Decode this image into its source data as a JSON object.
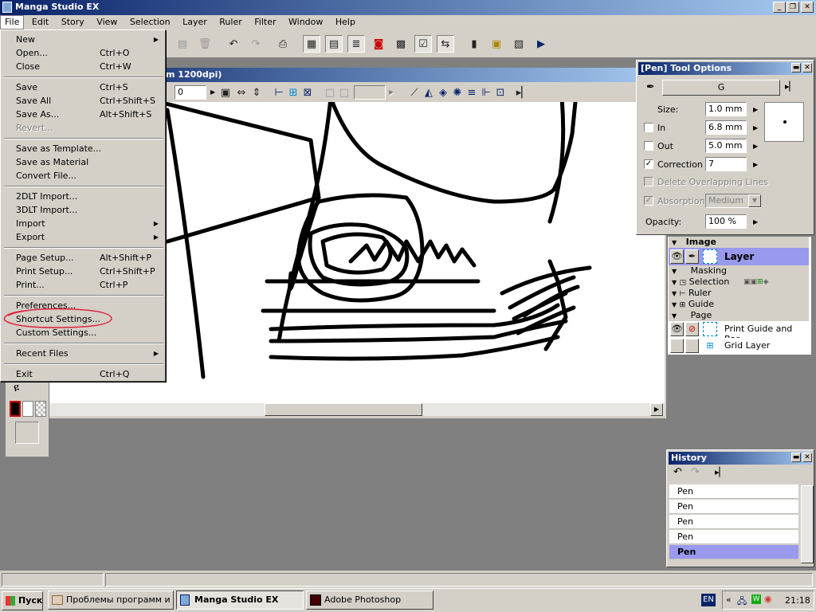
{
  "app": {
    "title": "Manga Studio EX"
  },
  "menubar": [
    "File",
    "Edit",
    "Story",
    "View",
    "Selection",
    "Layer",
    "Ruler",
    "Filter",
    "Window",
    "Help"
  ],
  "file_menu": [
    {
      "label": "New",
      "shortcut": "",
      "submenu": true,
      "disabled": false
    },
    {
      "label": "Open...",
      "shortcut": "Ctrl+O",
      "submenu": false,
      "disabled": false
    },
    {
      "label": "Close",
      "shortcut": "Ctrl+W",
      "submenu": false,
      "disabled": false
    },
    {
      "sep": true
    },
    {
      "label": "Save",
      "shortcut": "Ctrl+S",
      "submenu": false,
      "disabled": false
    },
    {
      "label": "Save All",
      "shortcut": "Ctrl+Shift+S",
      "submenu": false,
      "disabled": false
    },
    {
      "label": "Save As...",
      "shortcut": "Alt+Shift+S",
      "submenu": false,
      "disabled": false
    },
    {
      "label": "Revert...",
      "shortcut": "",
      "submenu": false,
      "disabled": true
    },
    {
      "sep": true
    },
    {
      "label": "Save as Template...",
      "shortcut": "",
      "submenu": false,
      "disabled": false
    },
    {
      "label": "Save as Material",
      "shortcut": "",
      "submenu": false,
      "disabled": false
    },
    {
      "label": "Convert File...",
      "shortcut": "",
      "submenu": false,
      "disabled": false
    },
    {
      "sep": true
    },
    {
      "label": "2DLT Import...",
      "shortcut": "",
      "submenu": false,
      "disabled": false
    },
    {
      "label": "3DLT Import...",
      "shortcut": "",
      "submenu": false,
      "disabled": false
    },
    {
      "label": "Import",
      "shortcut": "",
      "submenu": true,
      "disabled": false
    },
    {
      "label": "Export",
      "shortcut": "",
      "submenu": true,
      "disabled": false
    },
    {
      "sep": true
    },
    {
      "label": "Page Setup...",
      "shortcut": "Alt+Shift+P",
      "submenu": false,
      "disabled": false
    },
    {
      "label": "Print Setup...",
      "shortcut": "Ctrl+Shift+P",
      "submenu": false,
      "disabled": false
    },
    {
      "label": "Print...",
      "shortcut": "Ctrl+P",
      "submenu": false,
      "disabled": false
    },
    {
      "sep": true
    },
    {
      "label": "Preferences...",
      "shortcut": "",
      "submenu": false,
      "disabled": false
    },
    {
      "label": "Shortcut Settings...",
      "shortcut": "",
      "submenu": false,
      "disabled": false
    },
    {
      "label": "Custom Settings...",
      "shortcut": "",
      "submenu": false,
      "disabled": false
    },
    {
      "sep": true
    },
    {
      "label": "Recent Files",
      "shortcut": "",
      "submenu": true,
      "disabled": false
    },
    {
      "sep": true
    },
    {
      "label": "Exit",
      "shortcut": "Ctrl+Q",
      "submenu": false,
      "disabled": false
    }
  ],
  "doc": {
    "title_fragment": "m 1200dpi)",
    "zoom_field": "0"
  },
  "tool_options": {
    "title": "[Pen] Tool Options",
    "preset": "G",
    "size_label": "Size:",
    "size_value": "1.0 mm",
    "in_label": "In",
    "in_value": "6.8 mm",
    "in_checked": false,
    "out_label": "Out",
    "out_value": "5.0 mm",
    "out_checked": false,
    "correction_label": "Correction",
    "correction_value": "7",
    "correction_checked": true,
    "delete_label": "Delete Overlapping Lines",
    "absorption_label": "Absorption",
    "absorption_value": "Medium",
    "opacity_label": "Opacity:",
    "opacity_value": "100 %"
  },
  "layers": {
    "image_header": "Image",
    "layer_name": "Layer",
    "masking": "Masking",
    "selection": "Selection",
    "ruler": "Ruler",
    "guide": "Guide",
    "page": "Page",
    "print_guide": "Print Guide and Bas...",
    "grid_layer": "Grid Layer"
  },
  "history": {
    "title": "History",
    "items": [
      "Pen",
      "Pen",
      "Pen",
      "Pen",
      "Pen"
    ],
    "selected_index": 4
  },
  "taskbar": {
    "start": "Пуск",
    "tasks": [
      "Проблемы программ и р...",
      "Manga Studio EX",
      "Adobe Photoshop"
    ],
    "lang": "EN",
    "time": "21:18"
  }
}
